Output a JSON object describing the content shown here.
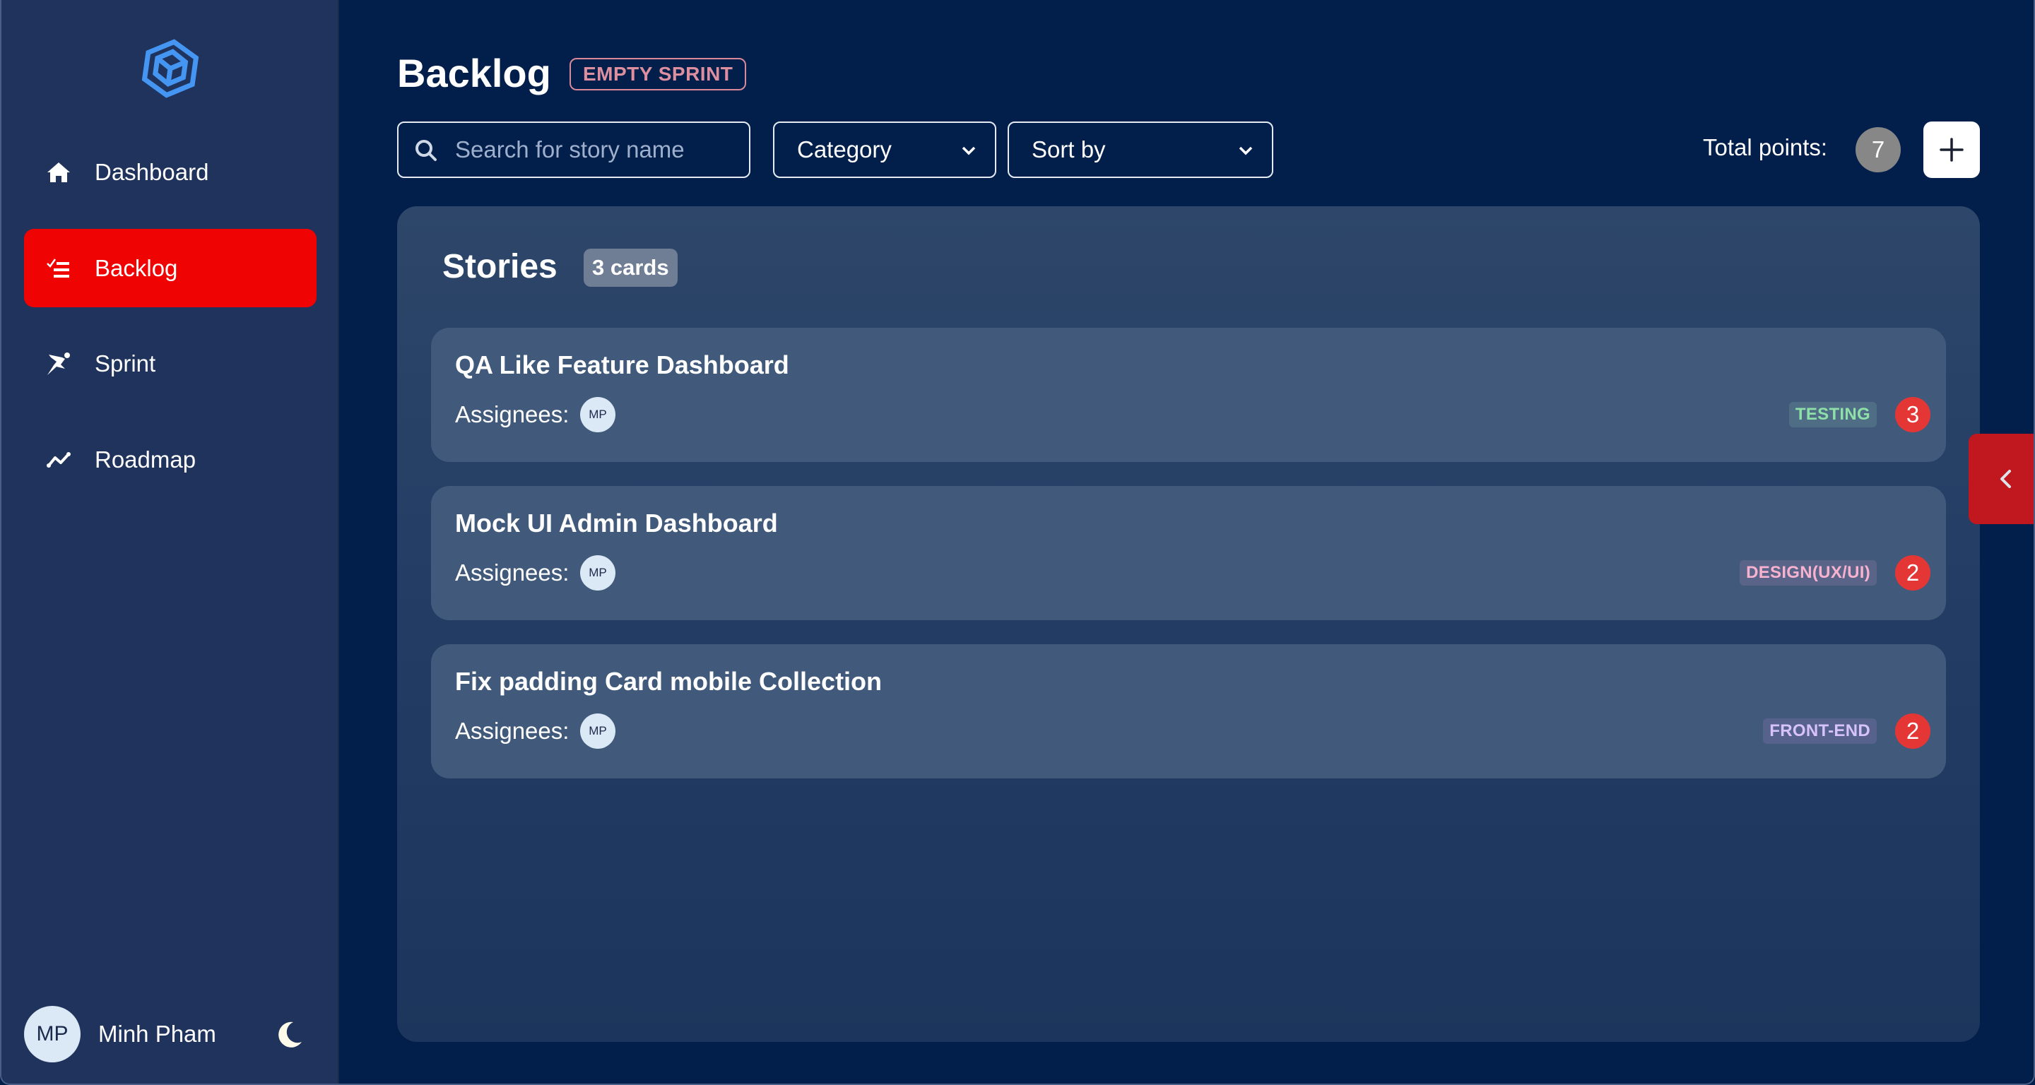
{
  "sidebar": {
    "logo_icon": "hexagon-cube-logo",
    "items": [
      {
        "label": "Dashboard",
        "icon": "home-icon",
        "active": false
      },
      {
        "label": "Backlog",
        "icon": "list-check-icon",
        "active": true
      },
      {
        "label": "Sprint",
        "icon": "running-person-icon",
        "active": false
      },
      {
        "label": "Roadmap",
        "icon": "trend-line-icon",
        "active": false
      }
    ],
    "user": {
      "initials": "MP",
      "name": "Minh Pham"
    },
    "theme_toggle_icon": "moon-icon"
  },
  "header": {
    "title": "Backlog",
    "badge": "EMPTY SPRINT",
    "search": {
      "placeholder": "Search for story name",
      "value": ""
    },
    "category_select": {
      "label": "Category"
    },
    "sort_select": {
      "label": "Sort by"
    },
    "total_points_label": "Total points:",
    "total_points": "7",
    "add_button_icon": "plus-icon"
  },
  "stories": {
    "title": "Stories",
    "count_label": "3 cards",
    "assignees_label": "Assignees:",
    "cards": [
      {
        "title": "QA Like Feature Dashboard",
        "assignee": "MP",
        "tag": "TESTING",
        "tag_color": "#8ee0a8",
        "tag_bg": "#4f6d85",
        "points": "3"
      },
      {
        "title": "Mock UI Admin Dashboard",
        "assignee": "MP",
        "tag": "DESIGN(UX/UI)",
        "tag_color": "#f7b2cf",
        "tag_bg": "#5a6488",
        "points": "2"
      },
      {
        "title": "Fix padding Card mobile Collection",
        "assignee": "MP",
        "tag": "FRONT-END",
        "tag_color": "#d8c2fb",
        "tag_bg": "#56628c",
        "points": "2"
      }
    ]
  },
  "drawer_tab_icon": "chevron-left-icon",
  "colors": {
    "accent_red": "#f00303",
    "points_red": "#e53636",
    "brand_blue": "#4596f2"
  }
}
